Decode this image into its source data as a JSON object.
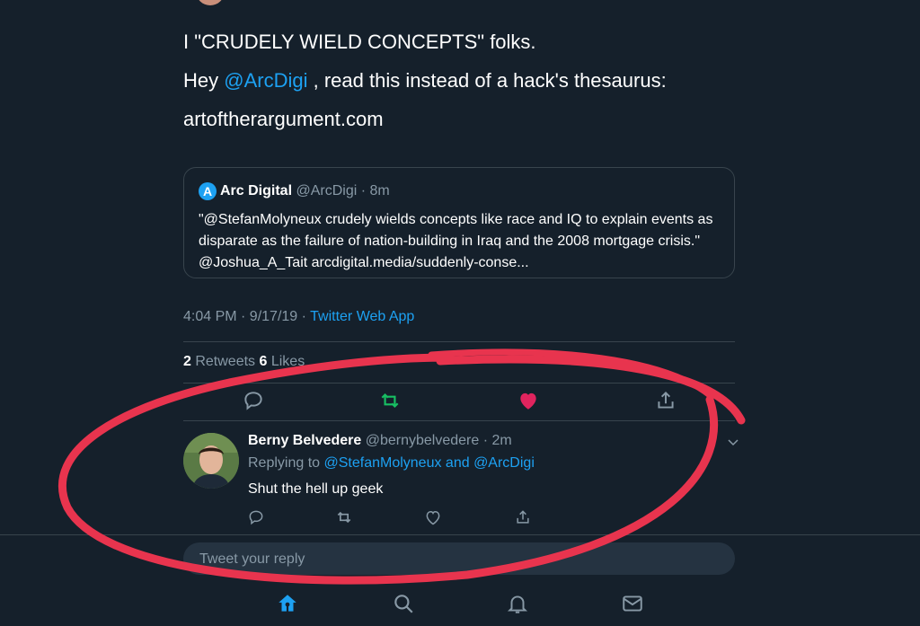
{
  "tweet": {
    "line1": "I \"CRUDELY WIELD CONCEPTS\" folks.",
    "line2_prefix": "Hey ",
    "line2_mention": "@ArcDigi",
    "line2_suffix": " , read this instead of a hack's thesaurus:",
    "link": "artoftherargument.com",
    "timestamp": "4:04 PM · 9/17/19 · ",
    "client": "Twitter Web App",
    "retweet_count": "2",
    "retweet_label": " Retweets ",
    "like_count": "6",
    "like_label": " Likes"
  },
  "quote": {
    "logo_letter": "A",
    "name": "Arc Digital",
    "handle_time": " @ArcDigi · 8m",
    "body": "\"@StefanMolyneux crudely wields concepts like race and IQ to explain events as disparate as the failure of nation-building in Iraq and the 2008 mortgage crisis.\" @Joshua_A_Tait arcdigital.media/suddenly-conse..."
  },
  "reply": {
    "name": "Berny Belvedere",
    "handle_time": " @bernybelvedere · 2m",
    "replying_prefix": "Replying to ",
    "replying_to": "@StefanMolyneux and @ArcDigi",
    "text": "Shut the hell up geek"
  },
  "composer": {
    "placeholder": "Tweet your reply"
  },
  "icons": {
    "reply": "reply-icon",
    "retweet": "retweet-icon",
    "like": "heart-icon",
    "share": "share-icon",
    "home": "home-icon",
    "search": "search-icon",
    "notifications": "bell-icon",
    "messages": "mail-icon"
  },
  "colors": {
    "background": "#15202b",
    "accent": "#1da1f2",
    "retweet_active": "#17bf63",
    "like_active": "#e0245e",
    "annotation": "#e8344e"
  }
}
